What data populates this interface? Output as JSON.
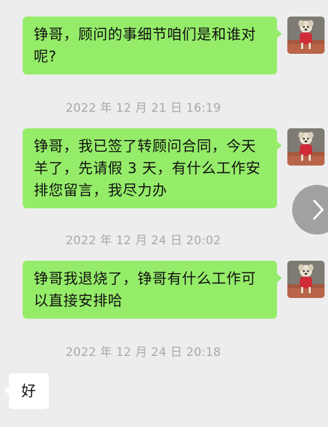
{
  "messages": [
    {
      "direction": "out",
      "text": "铮哥，顾问的事细节咱们是和谁对呢?"
    },
    {
      "timestamp": "2022 年 12 月 21 日  16:19"
    },
    {
      "direction": "out",
      "text": "铮哥，我已签了转顾问合同，今天羊了，先请假 3 天，有什么工作安排您留言，我尽力办"
    },
    {
      "timestamp": "2022 年 12 月 24 日  20:02"
    },
    {
      "direction": "out",
      "text": "铮哥我退烧了，铮哥有什么工作可以直接安排哈"
    },
    {
      "timestamp": "2022 年 12 月 24 日  20:18"
    },
    {
      "direction": "in",
      "text": "好"
    }
  ],
  "icons": {
    "avatar": "dog-photo-avatar",
    "nav": "chevron-right-icon"
  },
  "colors": {
    "background": "#ededed",
    "outgoing_bubble": "#95ec69",
    "incoming_bubble": "#ffffff",
    "timestamp_text": "#a8a8a8"
  }
}
